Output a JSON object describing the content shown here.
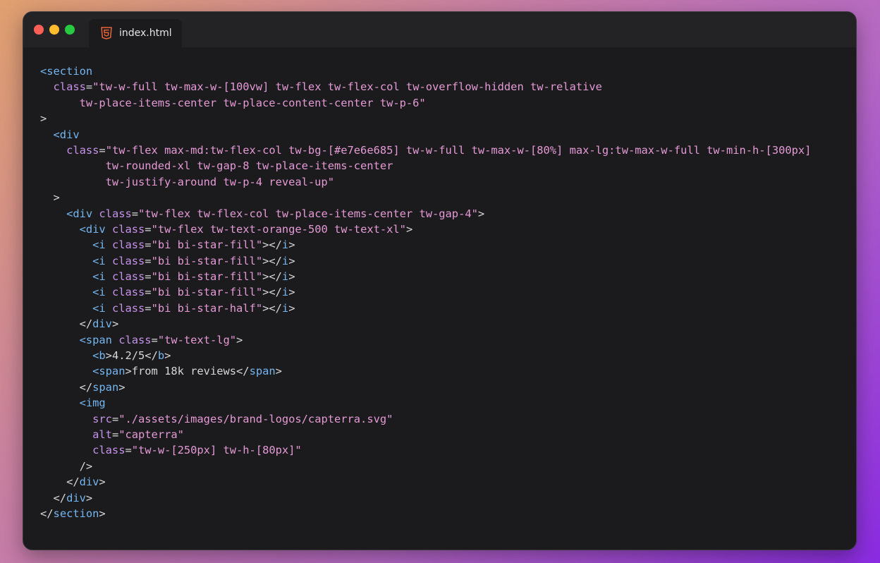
{
  "window": {
    "tab": {
      "title": "index.html",
      "icon": "html5-icon"
    },
    "controls": [
      "close-icon",
      "minimize-icon",
      "maximize-icon"
    ]
  },
  "colors": {
    "tag": "#74b6f0",
    "attribute": "#c792ea",
    "string": "#e59ad6",
    "text": "#d7d7d7",
    "editor_background": "#1b1b1d"
  },
  "code_lines": [
    [
      {
        "t": "tag",
        "v": "<section"
      }
    ],
    [
      {
        "t": "attr",
        "v": "  class"
      },
      {
        "t": "punc",
        "v": "="
      },
      {
        "t": "str",
        "v": "\"tw-w-full tw-max-w-[100vw] tw-flex tw-flex-col tw-overflow-hidden tw-relative"
      }
    ],
    [
      {
        "t": "str",
        "v": "      tw-place-items-center tw-place-content-center tw-p-6\""
      }
    ],
    [
      {
        "t": "punc",
        "v": ">"
      }
    ],
    [
      {
        "t": "tag",
        "v": "  <div"
      }
    ],
    [
      {
        "t": "attr",
        "v": "    class"
      },
      {
        "t": "punc",
        "v": "="
      },
      {
        "t": "str",
        "v": "\"tw-flex max-md:tw-flex-col tw-bg-[#e7e6e685] tw-w-full tw-max-w-[80%] max-lg:tw-max-w-full tw-min-h-[300px]"
      }
    ],
    [
      {
        "t": "str",
        "v": "          tw-rounded-xl tw-gap-8 tw-place-items-center"
      }
    ],
    [
      {
        "t": "str",
        "v": "          tw-justify-around tw-p-4 reveal-up\""
      }
    ],
    [
      {
        "t": "punc",
        "v": "  >"
      }
    ],
    [
      {
        "t": "tag",
        "v": "    <div"
      },
      {
        "t": "attr",
        "v": " class"
      },
      {
        "t": "punc",
        "v": "="
      },
      {
        "t": "str",
        "v": "\"tw-flex tw-flex-col tw-place-items-center tw-gap-4\""
      },
      {
        "t": "punc",
        "v": ">"
      }
    ],
    [
      {
        "t": "tag",
        "v": "      <div"
      },
      {
        "t": "attr",
        "v": " class"
      },
      {
        "t": "punc",
        "v": "="
      },
      {
        "t": "str",
        "v": "\"tw-flex tw-text-orange-500 tw-text-xl\""
      },
      {
        "t": "punc",
        "v": ">"
      }
    ],
    [
      {
        "t": "tag",
        "v": "        <i"
      },
      {
        "t": "attr",
        "v": " class"
      },
      {
        "t": "punc",
        "v": "="
      },
      {
        "t": "str",
        "v": "\"bi bi-star-fill\""
      },
      {
        "t": "punc",
        "v": "></"
      },
      {
        "t": "tag",
        "v": "i"
      },
      {
        "t": "punc",
        "v": ">"
      }
    ],
    [
      {
        "t": "tag",
        "v": "        <i"
      },
      {
        "t": "attr",
        "v": " class"
      },
      {
        "t": "punc",
        "v": "="
      },
      {
        "t": "str",
        "v": "\"bi bi-star-fill\""
      },
      {
        "t": "punc",
        "v": "></"
      },
      {
        "t": "tag",
        "v": "i"
      },
      {
        "t": "punc",
        "v": ">"
      }
    ],
    [
      {
        "t": "tag",
        "v": "        <i"
      },
      {
        "t": "attr",
        "v": " class"
      },
      {
        "t": "punc",
        "v": "="
      },
      {
        "t": "str",
        "v": "\"bi bi-star-fill\""
      },
      {
        "t": "punc",
        "v": "></"
      },
      {
        "t": "tag",
        "v": "i"
      },
      {
        "t": "punc",
        "v": ">"
      }
    ],
    [
      {
        "t": "tag",
        "v": "        <i"
      },
      {
        "t": "attr",
        "v": " class"
      },
      {
        "t": "punc",
        "v": "="
      },
      {
        "t": "str",
        "v": "\"bi bi-star-fill\""
      },
      {
        "t": "punc",
        "v": "></"
      },
      {
        "t": "tag",
        "v": "i"
      },
      {
        "t": "punc",
        "v": ">"
      }
    ],
    [
      {
        "t": "tag",
        "v": "        <i"
      },
      {
        "t": "attr",
        "v": " class"
      },
      {
        "t": "punc",
        "v": "="
      },
      {
        "t": "str",
        "v": "\"bi bi-star-half\""
      },
      {
        "t": "punc",
        "v": "></"
      },
      {
        "t": "tag",
        "v": "i"
      },
      {
        "t": "punc",
        "v": ">"
      }
    ],
    [
      {
        "t": "punc",
        "v": "      </"
      },
      {
        "t": "tag",
        "v": "div"
      },
      {
        "t": "punc",
        "v": ">"
      }
    ],
    [
      {
        "t": "tag",
        "v": "      <span"
      },
      {
        "t": "attr",
        "v": " class"
      },
      {
        "t": "punc",
        "v": "="
      },
      {
        "t": "str",
        "v": "\"tw-text-lg\""
      },
      {
        "t": "punc",
        "v": ">"
      }
    ],
    [
      {
        "t": "tag",
        "v": "        <b"
      },
      {
        "t": "punc",
        "v": ">"
      },
      {
        "t": "text",
        "v": "4.2/5"
      },
      {
        "t": "punc",
        "v": "</"
      },
      {
        "t": "tag",
        "v": "b"
      },
      {
        "t": "punc",
        "v": ">"
      }
    ],
    [
      {
        "t": "tag",
        "v": "        <span"
      },
      {
        "t": "punc",
        "v": ">"
      },
      {
        "t": "text",
        "v": "from 18k reviews"
      },
      {
        "t": "punc",
        "v": "</"
      },
      {
        "t": "tag",
        "v": "span"
      },
      {
        "t": "punc",
        "v": ">"
      }
    ],
    [
      {
        "t": "punc",
        "v": "      </"
      },
      {
        "t": "tag",
        "v": "span"
      },
      {
        "t": "punc",
        "v": ">"
      }
    ],
    [
      {
        "t": "tag",
        "v": "      <img"
      }
    ],
    [
      {
        "t": "attr",
        "v": "        src"
      },
      {
        "t": "punc",
        "v": "="
      },
      {
        "t": "str",
        "v": "\"./assets/images/brand-logos/capterra.svg\""
      }
    ],
    [
      {
        "t": "attr",
        "v": "        alt"
      },
      {
        "t": "punc",
        "v": "="
      },
      {
        "t": "str",
        "v": "\"capterra\""
      }
    ],
    [
      {
        "t": "attr",
        "v": "        class"
      },
      {
        "t": "punc",
        "v": "="
      },
      {
        "t": "str",
        "v": "\"tw-w-[250px] tw-h-[80px]\""
      }
    ],
    [
      {
        "t": "punc",
        "v": "      />"
      }
    ],
    [
      {
        "t": "punc",
        "v": "    </"
      },
      {
        "t": "tag",
        "v": "div"
      },
      {
        "t": "punc",
        "v": ">"
      }
    ],
    [
      {
        "t": "punc",
        "v": "  </"
      },
      {
        "t": "tag",
        "v": "div"
      },
      {
        "t": "punc",
        "v": ">"
      }
    ],
    [
      {
        "t": "punc",
        "v": "</"
      },
      {
        "t": "tag",
        "v": "section"
      },
      {
        "t": "punc",
        "v": ">"
      }
    ]
  ]
}
